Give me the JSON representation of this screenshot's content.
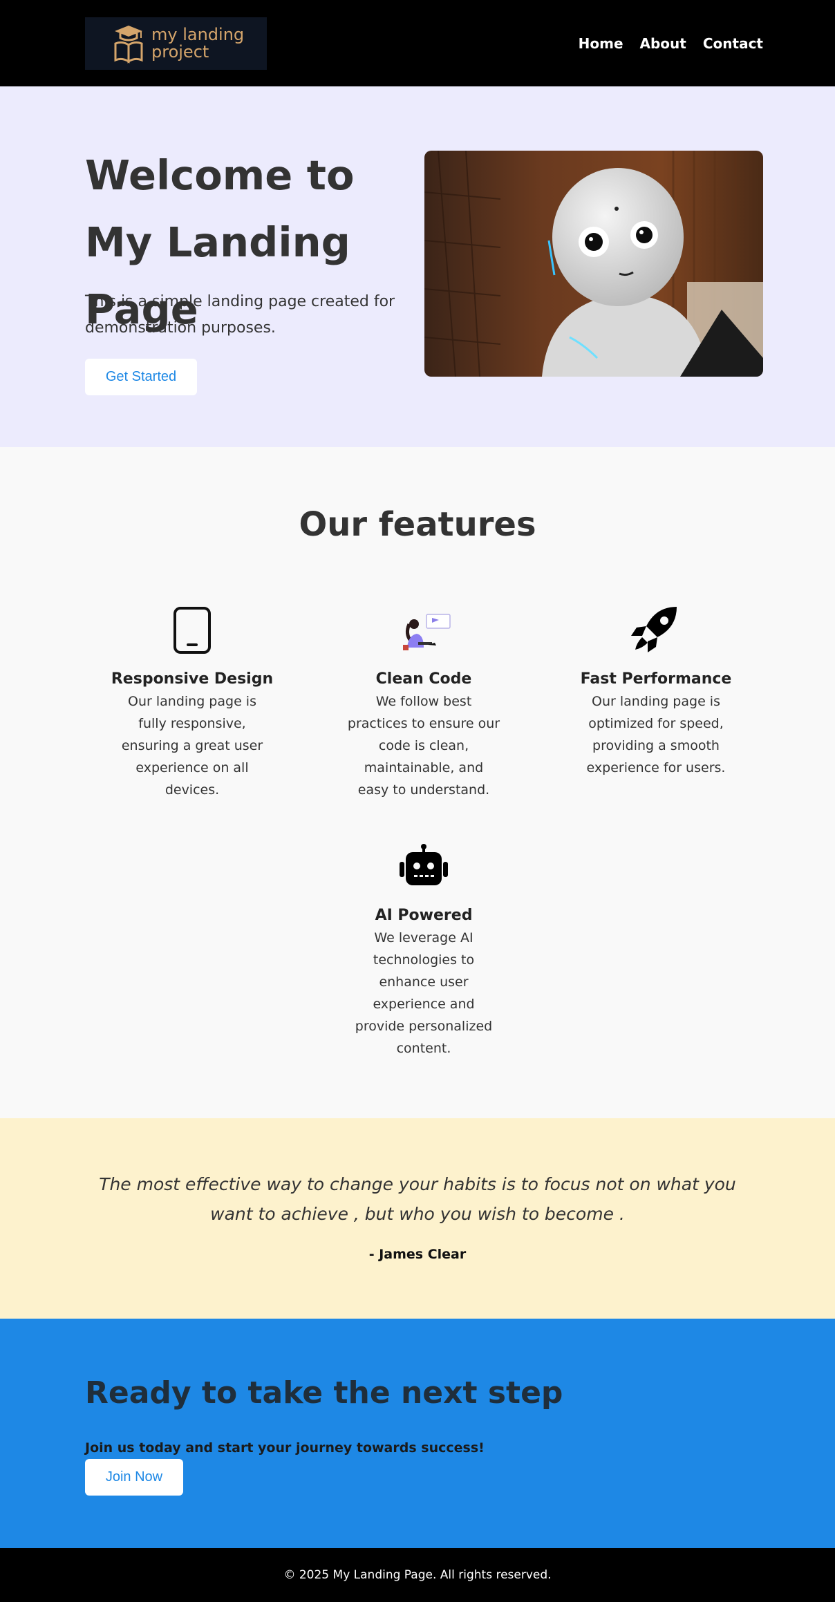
{
  "nav": {
    "logo_text": "my landing\nproject",
    "links": [
      "Home",
      "About",
      "Contact"
    ]
  },
  "hero": {
    "title": "Welcome to My Landing Page",
    "subtitle": "This is a simple landing page created for demonstration purposes.",
    "button": "Get Started",
    "image_alt": "robot-photo"
  },
  "features": {
    "title": "Our features",
    "items": [
      {
        "icon": "tablet-icon",
        "title": "Responsive Design",
        "desc": "Our landing page is fully responsive, ensuring a great user experience on all devices."
      },
      {
        "icon": "developer-illustration-icon",
        "title": "Clean Code",
        "desc": "We follow best practices to ensure our code is clean, maintainable, and easy to understand."
      },
      {
        "icon": "rocket-icon",
        "title": "Fast Performance",
        "desc": "Our landing page is optimized for speed, providing a smooth experience for users."
      },
      {
        "icon": "robot-icon",
        "title": "AI Powered",
        "desc": "We leverage AI technologies to enhance user experience and provide personalized content."
      }
    ]
  },
  "quote": {
    "text": "The most effective way to change your habits is to focus not on what you want to achieve , but who you wish to become .",
    "author": "- James Clear"
  },
  "cta": {
    "title": "Ready to take the next step",
    "subtitle": "Join us today and start your journey towards success!",
    "button": "Join Now"
  },
  "footer": {
    "text": "© 2025 My Landing Page. All rights reserved."
  },
  "colors": {
    "nav_bg": "#000000",
    "hero_bg": "#ecebfd",
    "quote_bg": "#fdf2cd",
    "cta_bg": "#1e88e5",
    "accent": "#1e88e5",
    "logo_gold": "#d5a56b"
  }
}
